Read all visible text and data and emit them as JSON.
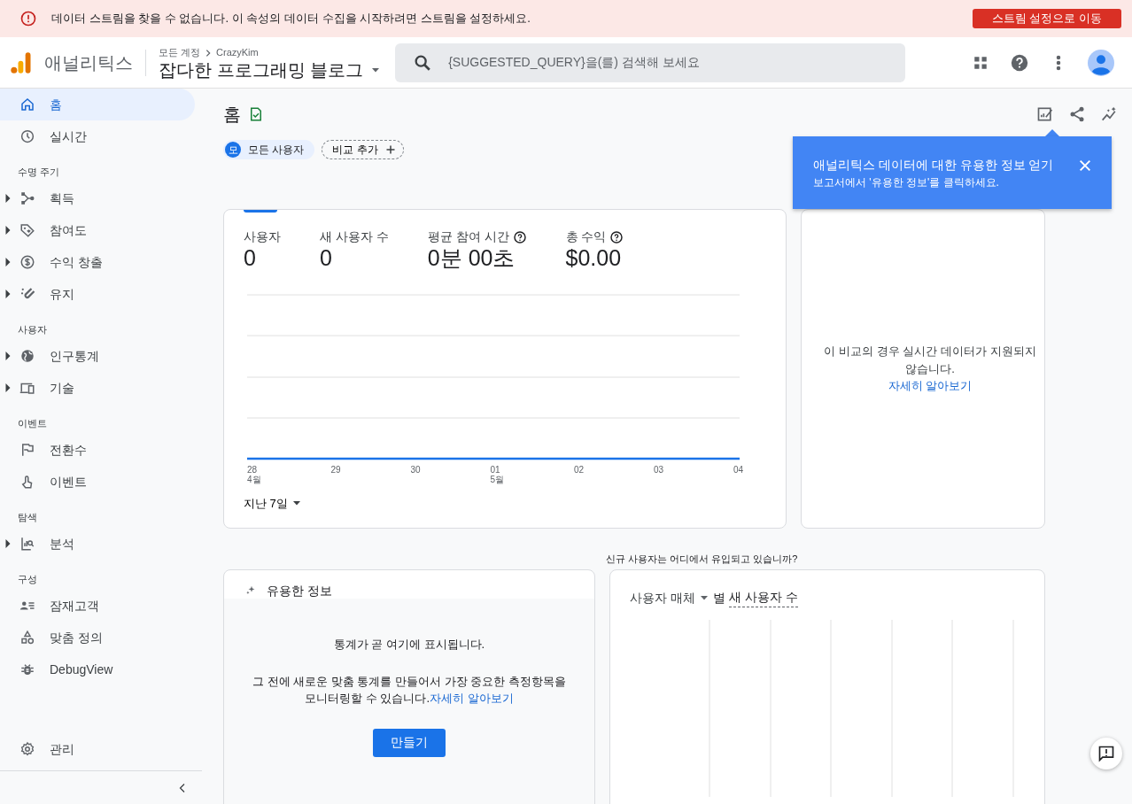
{
  "alert": {
    "text": "데이터 스트림을 찾을 수 없습니다. 이 속성의 데이터 수집을 시작하려면 스트림을 설정하세요.",
    "button": "스트림 설정으로 이동"
  },
  "header": {
    "product": "애널리틱스",
    "breadcrumb_root": "모든 계정",
    "breadcrumb_account": "CrazyKim",
    "property": "잡다한 프로그래밍 블로그",
    "search": {
      "placeholder": "{SUGGESTED_QUERY}을(를) 검색해 보세요"
    }
  },
  "sidebar": {
    "items": [
      {
        "kind": "item",
        "label": "홈",
        "selected": true,
        "expandable": false
      },
      {
        "kind": "item",
        "label": "실시간",
        "selected": false,
        "expandable": false
      },
      {
        "kind": "section",
        "label": "수명 주기"
      },
      {
        "kind": "item",
        "label": "획득",
        "selected": false,
        "expandable": true
      },
      {
        "kind": "item",
        "label": "참여도",
        "selected": false,
        "expandable": true
      },
      {
        "kind": "item",
        "label": "수익 창출",
        "selected": false,
        "expandable": true
      },
      {
        "kind": "item",
        "label": "유지",
        "selected": false,
        "expandable": true
      },
      {
        "kind": "section",
        "label": "사용자"
      },
      {
        "kind": "item",
        "label": "인구통계",
        "selected": false,
        "expandable": true
      },
      {
        "kind": "item",
        "label": "기술",
        "selected": false,
        "expandable": true
      },
      {
        "kind": "section",
        "label": "이벤트"
      },
      {
        "kind": "item",
        "label": "전환수",
        "selected": false,
        "expandable": false
      },
      {
        "kind": "item",
        "label": "이벤트",
        "selected": false,
        "expandable": false
      },
      {
        "kind": "section",
        "label": "탐색"
      },
      {
        "kind": "item",
        "label": "분석",
        "selected": false,
        "expandable": true
      },
      {
        "kind": "section",
        "label": "구성"
      },
      {
        "kind": "item",
        "label": "잠재고객",
        "selected": false,
        "expandable": false
      },
      {
        "kind": "item",
        "label": "맞춤 정의",
        "selected": false,
        "expandable": false
      },
      {
        "kind": "item",
        "label": "DebugView",
        "selected": false,
        "expandable": false
      }
    ],
    "admin": "관리"
  },
  "page": {
    "title": "홈",
    "segment_badge": "모",
    "segment": "모든 사용자",
    "compare": "비교 추가"
  },
  "tooltip": {
    "title": "애널리틱스 데이터에 대한 유용한 정보 얻기",
    "text": "보고서에서 '유용한 정보'를 클릭하세요."
  },
  "overview": {
    "metrics": [
      {
        "label": "사용자",
        "value": "0",
        "help": false
      },
      {
        "label": "새 사용자 수",
        "value": "0",
        "help": false
      },
      {
        "label": "평균 참여 시간",
        "value": "0분 00초",
        "help": true
      },
      {
        "label": "총 수익",
        "value": "$0.00",
        "help": true
      }
    ],
    "x_labels": [
      {
        "day": "28",
        "month": "4월"
      },
      {
        "day": "29"
      },
      {
        "day": "30"
      },
      {
        "day": "01",
        "month": "5월"
      },
      {
        "day": "02"
      },
      {
        "day": "03"
      },
      {
        "day": "04"
      }
    ],
    "range": "지난 7일"
  },
  "realtime": {
    "text": "이 비교의 경우 실시간 데이터가 지원되지 않습니다.",
    "link": "자세히 알아보기"
  },
  "insights": {
    "title": "유용한 정보",
    "heading": "통계가 곧 여기에 표시됩니다.",
    "text": "그 전에 새로운 맞춤 통계를 만들어서 가장 중요한 측정항목을 모니터링할 수 있습니다.",
    "link": "자세히 알아보기",
    "button": "만들기"
  },
  "acquisition": {
    "question": "신규 사용자는 어디에서 유입되고 있습니까?",
    "dimension": "사용자 매체",
    "by": "별",
    "metric": "새 사용자 수"
  }
}
